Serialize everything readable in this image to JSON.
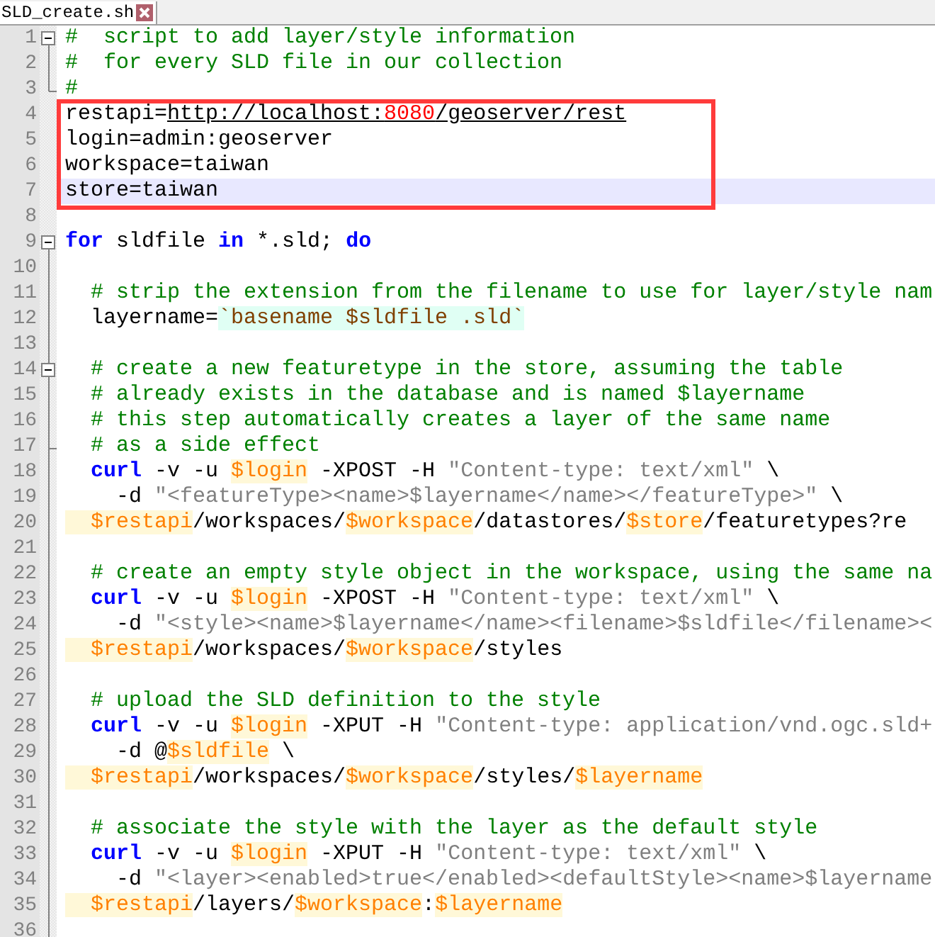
{
  "tab": {
    "title": "SLD_create.sh",
    "selected": true
  },
  "lines": [
    {
      "number": "1",
      "expanded": true,
      "current": false,
      "framed": false,
      "tokens": [
        {
          "kind": "comment",
          "text": "#  script to add layer/style information"
        }
      ],
      "children": [
        {
          "number": "2",
          "current": false,
          "framed": false,
          "tokens": [
            {
              "kind": "comment",
              "text": "#  for every SLD file in our collection"
            }
          ]
        },
        {
          "number": "3",
          "fold_end": true,
          "current": false,
          "framed": false,
          "tokens": [
            {
              "kind": "comment",
              "text": "#"
            }
          ]
        }
      ]
    },
    {
      "number": "4",
      "current": false,
      "framed": true,
      "tokens": [
        {
          "kind": "plain",
          "text": "restapi="
        },
        {
          "kind": "url",
          "text": "http://localhost:"
        },
        {
          "kind": "url_number",
          "text": "8080"
        },
        {
          "kind": "url",
          "text": "/geoserver/rest"
        }
      ]
    },
    {
      "number": "5",
      "current": false,
      "framed": true,
      "tokens": [
        {
          "kind": "plain",
          "text": "login=admin:geoserver"
        }
      ]
    },
    {
      "number": "6",
      "current": false,
      "framed": true,
      "tokens": [
        {
          "kind": "plain",
          "text": "workspace=taiwan"
        }
      ]
    },
    {
      "number": "7",
      "current": true,
      "framed": true,
      "tokens": [
        {
          "kind": "plain",
          "text": "store=taiwan"
        }
      ]
    },
    {
      "number": "8",
      "current": false,
      "framed": false
    },
    {
      "number": "9",
      "expanded": true,
      "current": false,
      "framed": false,
      "tokens": [
        {
          "kind": "keyword",
          "text": "for"
        },
        {
          "kind": "plain",
          "text": " sldfile "
        },
        {
          "kind": "keyword",
          "text": "in"
        },
        {
          "kind": "plain",
          "text": " *.sld; "
        },
        {
          "kind": "keyword",
          "text": "do"
        }
      ],
      "children": [
        {
          "number": "10",
          "current": false,
          "framed": false
        },
        {
          "number": "11",
          "current": false,
          "framed": false,
          "tokens": [
            {
              "kind": "comment",
              "text": "  # strip the extension from the filename to use for layer/style nam"
            }
          ]
        },
        {
          "number": "12",
          "current": false,
          "framed": false,
          "tokens": [
            {
              "kind": "plain",
              "text": "  layername="
            },
            {
              "kind": "backtick",
              "text": "`basename $sldfile .sld`"
            }
          ]
        },
        {
          "number": "13",
          "current": false,
          "framed": false
        },
        {
          "number": "14",
          "expanded": true,
          "current": false,
          "framed": false,
          "tokens": [
            {
              "kind": "comment",
              "text": "  # create a new featuretype in the store, assuming the table"
            }
          ],
          "children": [
            {
              "number": "15",
              "current": false,
              "framed": false,
              "tokens": [
                {
                  "kind": "comment",
                  "text": "  # already exists in the database and is named $layername"
                }
              ]
            },
            {
              "number": "16",
              "current": false,
              "framed": false,
              "tokens": [
                {
                  "kind": "comment",
                  "text": "  # this step automatically creates a layer of the same name"
                }
              ]
            },
            {
              "number": "17",
              "fold_end": true,
              "current": false,
              "framed": false,
              "tokens": [
                {
                  "kind": "comment",
                  "text": "  # as a side effect"
                }
              ]
            }
          ]
        },
        {
          "number": "18",
          "current": false,
          "framed": false,
          "tokens": [
            {
              "kind": "keyword",
              "text": "  curl"
            },
            {
              "kind": "plain",
              "text": " -v -u "
            },
            {
              "kind": "variable",
              "text": "$login"
            },
            {
              "kind": "plain",
              "text": " -XPOST -H "
            },
            {
              "kind": "string",
              "text": "\"Content-type: text/xml\""
            },
            {
              "kind": "plain",
              "text": " \\"
            }
          ]
        },
        {
          "number": "19",
          "current": false,
          "framed": false,
          "tokens": [
            {
              "kind": "plain",
              "text": "    -d "
            },
            {
              "kind": "string",
              "text": "\"<featureType><name>$layername</name></featureType>\""
            },
            {
              "kind": "plain",
              "text": " \\"
            }
          ]
        },
        {
          "number": "20",
          "current": false,
          "framed": false,
          "tokens": [
            {
              "kind": "variable",
              "text": "  $restapi"
            },
            {
              "kind": "plain",
              "text": "/workspaces/"
            },
            {
              "kind": "variable",
              "text": "$workspace"
            },
            {
              "kind": "plain",
              "text": "/datastores/"
            },
            {
              "kind": "variable",
              "text": "$store"
            },
            {
              "kind": "plain",
              "text": "/featuretypes?re"
            }
          ]
        },
        {
          "number": "21",
          "current": false,
          "framed": false
        },
        {
          "number": "22",
          "current": false,
          "framed": false,
          "tokens": [
            {
              "kind": "comment",
              "text": "  # create an empty style object in the workspace, using the same na"
            }
          ]
        },
        {
          "number": "23",
          "current": false,
          "framed": false,
          "tokens": [
            {
              "kind": "keyword",
              "text": "  curl"
            },
            {
              "kind": "plain",
              "text": " -v -u "
            },
            {
              "kind": "variable",
              "text": "$login"
            },
            {
              "kind": "plain",
              "text": " -XPOST -H "
            },
            {
              "kind": "string",
              "text": "\"Content-type: text/xml\""
            },
            {
              "kind": "plain",
              "text": " \\"
            }
          ]
        },
        {
          "number": "24",
          "current": false,
          "framed": false,
          "tokens": [
            {
              "kind": "plain",
              "text": "    -d "
            },
            {
              "kind": "string",
              "text": "\"<style><name>$layername</name><filename>$sldfile</filename><"
            }
          ]
        },
        {
          "number": "25",
          "current": false,
          "framed": false,
          "tokens": [
            {
              "kind": "variable",
              "text": "  $restapi"
            },
            {
              "kind": "plain",
              "text": "/workspaces/"
            },
            {
              "kind": "variable",
              "text": "$workspace"
            },
            {
              "kind": "plain",
              "text": "/styles"
            }
          ]
        },
        {
          "number": "26",
          "current": false,
          "framed": false
        },
        {
          "number": "27",
          "current": false,
          "framed": false,
          "tokens": [
            {
              "kind": "comment",
              "text": "  # upload the SLD definition to the style"
            }
          ]
        },
        {
          "number": "28",
          "current": false,
          "framed": false,
          "tokens": [
            {
              "kind": "keyword",
              "text": "  curl"
            },
            {
              "kind": "plain",
              "text": " -v -u "
            },
            {
              "kind": "variable",
              "text": "$login"
            },
            {
              "kind": "plain",
              "text": " -XPUT -H "
            },
            {
              "kind": "string",
              "text": "\"Content-type: application/vnd.ogc.sld+"
            }
          ]
        },
        {
          "number": "29",
          "current": false,
          "framed": false,
          "tokens": [
            {
              "kind": "plain",
              "text": "    -d @"
            },
            {
              "kind": "variable",
              "text": "$sldfile"
            },
            {
              "kind": "plain",
              "text": " \\"
            }
          ]
        },
        {
          "number": "30",
          "current": false,
          "framed": false,
          "tokens": [
            {
              "kind": "variable",
              "text": "  $restapi"
            },
            {
              "kind": "plain",
              "text": "/workspaces/"
            },
            {
              "kind": "variable",
              "text": "$workspace"
            },
            {
              "kind": "plain",
              "text": "/styles/"
            },
            {
              "kind": "variable",
              "text": "$layername"
            }
          ]
        },
        {
          "number": "31",
          "current": false,
          "framed": false
        },
        {
          "number": "32",
          "current": false,
          "framed": false,
          "tokens": [
            {
              "kind": "comment",
              "text": "  # associate the style with the layer as the default style"
            }
          ]
        },
        {
          "number": "33",
          "current": false,
          "framed": false,
          "tokens": [
            {
              "kind": "keyword",
              "text": "  curl"
            },
            {
              "kind": "plain",
              "text": " -v -u "
            },
            {
              "kind": "variable",
              "text": "$login"
            },
            {
              "kind": "plain",
              "text": " -XPUT -H "
            },
            {
              "kind": "string",
              "text": "\"Content-type: text/xml\""
            },
            {
              "kind": "plain",
              "text": " \\"
            }
          ]
        },
        {
          "number": "34",
          "current": false,
          "framed": false,
          "tokens": [
            {
              "kind": "plain",
              "text": "    -d "
            },
            {
              "kind": "string",
              "text": "\"<layer><enabled>true</enabled><defaultStyle><name>$layername"
            }
          ]
        },
        {
          "number": "35",
          "current": false,
          "framed": false,
          "tokens": [
            {
              "kind": "variable",
              "text": "  $restapi"
            },
            {
              "kind": "plain",
              "text": "/layers/"
            },
            {
              "kind": "variable",
              "text": "$workspace"
            },
            {
              "kind": "plain",
              "text": ":"
            },
            {
              "kind": "variable",
              "text": "$layername"
            }
          ]
        },
        {
          "number": "36",
          "current": false,
          "framed": false
        }
      ]
    }
  ]
}
